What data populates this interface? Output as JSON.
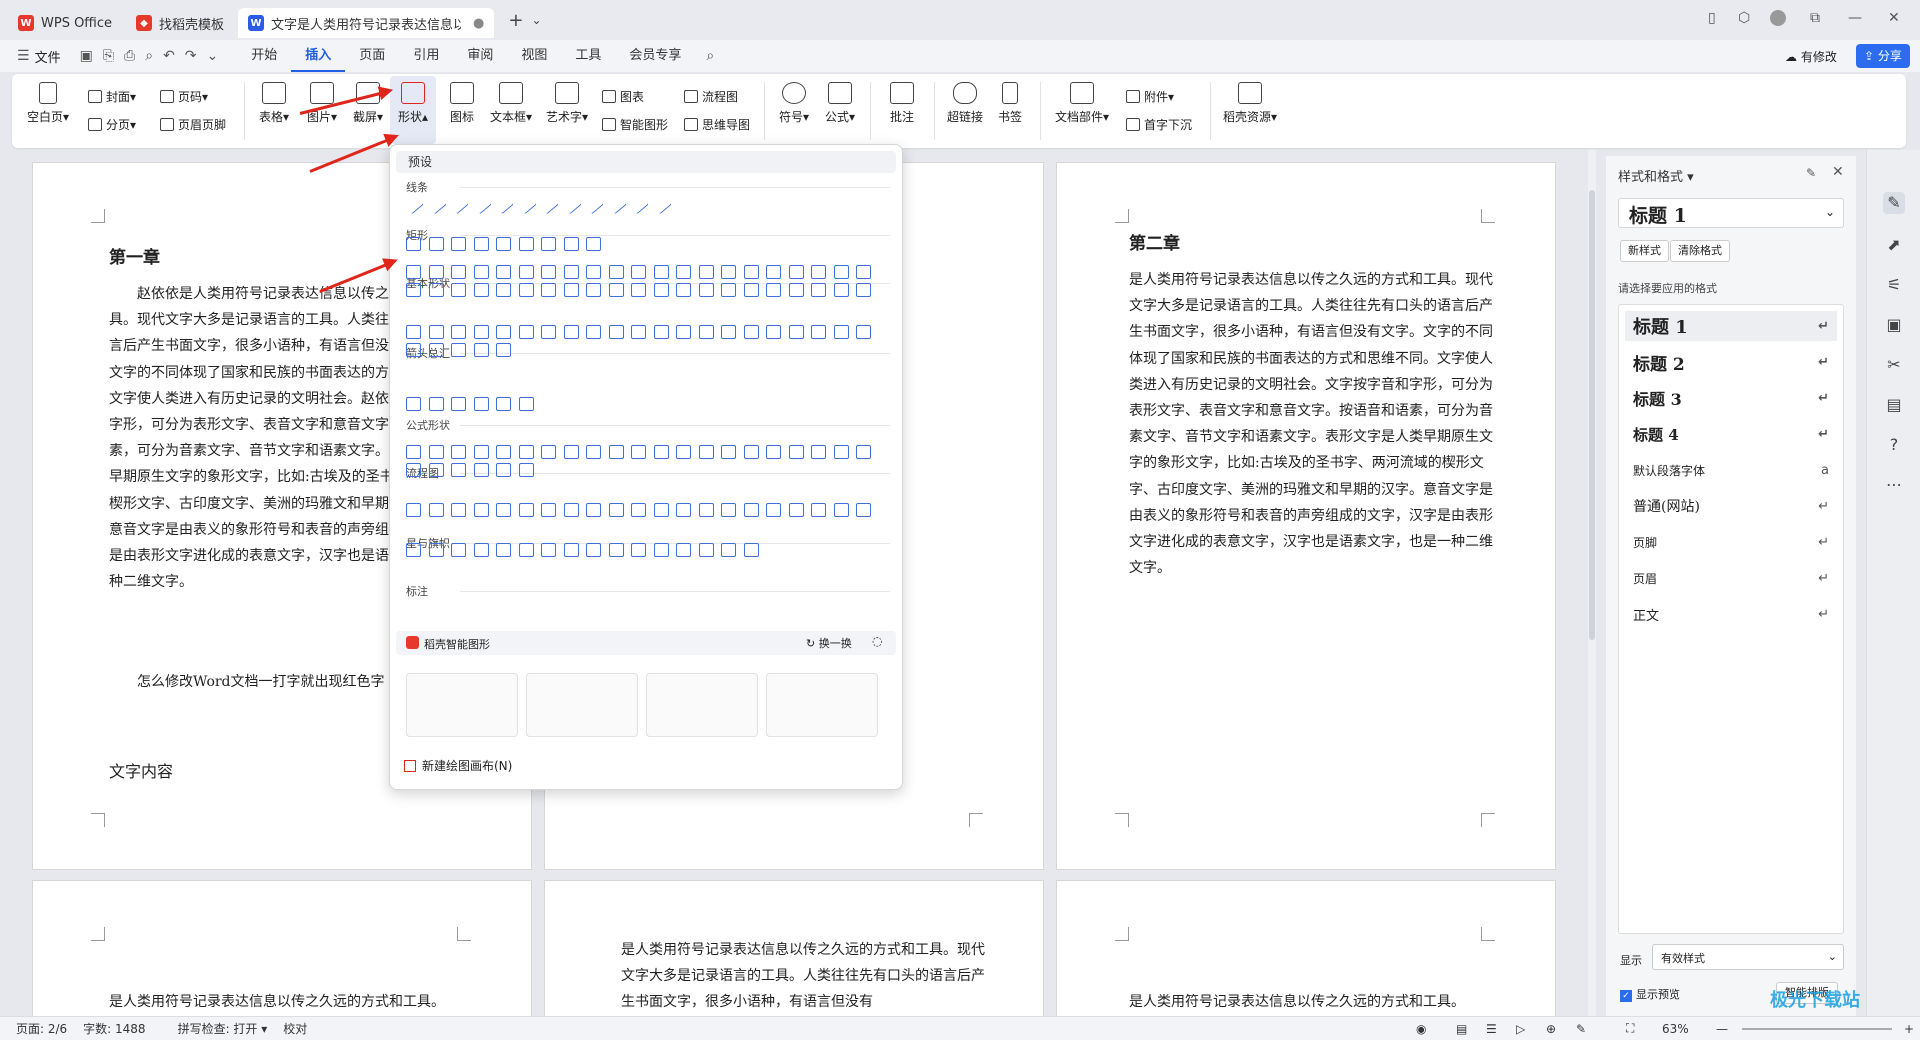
{
  "tabs": [
    {
      "label": "WPS Office",
      "icon": "wps-logo-icon"
    },
    {
      "label": "找稻壳模板",
      "icon": "docer-icon"
    },
    {
      "label": "文字是人类用符号记录表达信息以",
      "icon": "writer-doc-icon"
    }
  ],
  "menubar": {
    "file": "文件",
    "items": [
      "开始",
      "插入",
      "页面",
      "引用",
      "审阅",
      "视图",
      "工具",
      "会员专享"
    ],
    "active": "插入",
    "modified": "有修改",
    "share": "分享"
  },
  "ribbon": {
    "blank_page": "空白页",
    "cover": "封面",
    "page_break": "分页",
    "page_number": "页码",
    "header_footer": "页眉页脚",
    "table": "表格",
    "picture": "图片",
    "screenshot": "截屏",
    "shape": "形状",
    "icon": "图标",
    "textbox": "文本框",
    "wordart": "艺术字",
    "chart": "图表",
    "smartart": "智能图形",
    "flowchart": "流程图",
    "mindmap": "思维导图",
    "symbol": "符号",
    "formula": "公式",
    "comment": "批注",
    "hyperlink": "超链接",
    "bookmark": "书签",
    "doc_parts": "文档部件",
    "attachment": "附件",
    "dropcap": "首字下沉",
    "docer_resource": "稻壳资源"
  },
  "shape_panel": {
    "preset": "预设",
    "categories": [
      "线条",
      "矩形",
      "基本形状",
      "箭头总汇",
      "公式形状",
      "流程图",
      "星与旗帜",
      "标注"
    ],
    "smart_title": "稻壳智能图形",
    "refresh": "换一换",
    "new_canvas": "新建绘图画布(N)"
  },
  "pages": {
    "p1_heading": "第一章",
    "p1_body": "赵依依是人类用符号记录表达信息以传之久远的方式和工具。现代文字大多是记录语言的工具。人类往往先有口头的语言后产生书面文字，很多小语种，有语言但没有文字。赵依依文字的不同体现了国家和民族的书面表达的方式和思维不同。文字使人类进入有历史记录的文明社会。赵依依文字按字音和字形，可分为表形文字、表音文字和意音文字。按语音和语素，可分为音素文字、音节文字和语素文字。表形文字是人类早期原生文字的象形文字，比如:古埃及的圣书字、两河流域的楔形文字、古印度文字、美洲的玛雅文和早期的汉字。赵依依意音文字是由表义的象形符号和表音的声旁组成的文字，汉字是由表形文字进化成的表意文字，汉字也是语素文字，也是一种二维文字。",
    "p1_line2": "怎么修改Word文档一打字就出现红色字",
    "p1_section": "文字内容",
    "p3_heading": "第二章",
    "p3_body": "是人类用符号记录表达信息以传之久远的方式和工具。现代文字大多是记录语言的工具。人类往往先有口头的语言后产生书面文字，很多小语种，有语言但没有文字。文字的不同体现了国家和民族的书面表达的方式和思维不同。文字使人类进入有历史记录的文明社会。文字按字音和字形，可分为表形文字、表音文字和意音文字。按语音和语素，可分为音素文字、音节文字和语素文字。表形文字是人类早期原生文字的象形文字，比如:古埃及的圣书字、两河流域的楔形文字、古印度文字、美洲的玛雅文和早期的汉字。意音文字是由表义的象形符号和表音的声旁组成的文字，汉字是由表形文字进化成的表意文字，汉字也是语素文字，也是一种二维文字。",
    "p4_line": "是人类用符号记录表达信息以传之久远的方式和工具。",
    "p5_body": "是人类用符号记录表达信息以传之久远的方式和工具。现代文字大多是记录语言的工具。人类往往先有口头的语言后产生书面文字，很多小语种，有语言但没有",
    "p6_line": "是人类用符号记录表达信息以传之久远的方式和工具。"
  },
  "style_panel": {
    "title": "样式和格式",
    "current": "标题 1",
    "new_style": "新样式",
    "clear_format": "清除格式",
    "apply_label": "请选择要应用的格式",
    "styles": [
      "标题 1",
      "标题 2",
      "标题 3",
      "标题 4",
      "默认段落字体",
      "普通(网站)",
      "页脚",
      "页眉",
      "正文"
    ],
    "show_label": "显示",
    "show_value": "有效样式",
    "preview": "显示预览",
    "smart_layout": "智能排版"
  },
  "status": {
    "page": "页面: 2/6",
    "words": "字数: 1488",
    "spell": "拼写检查: 打开",
    "proof": "校对",
    "zoom": "63%"
  },
  "watermark": "极光下载站"
}
